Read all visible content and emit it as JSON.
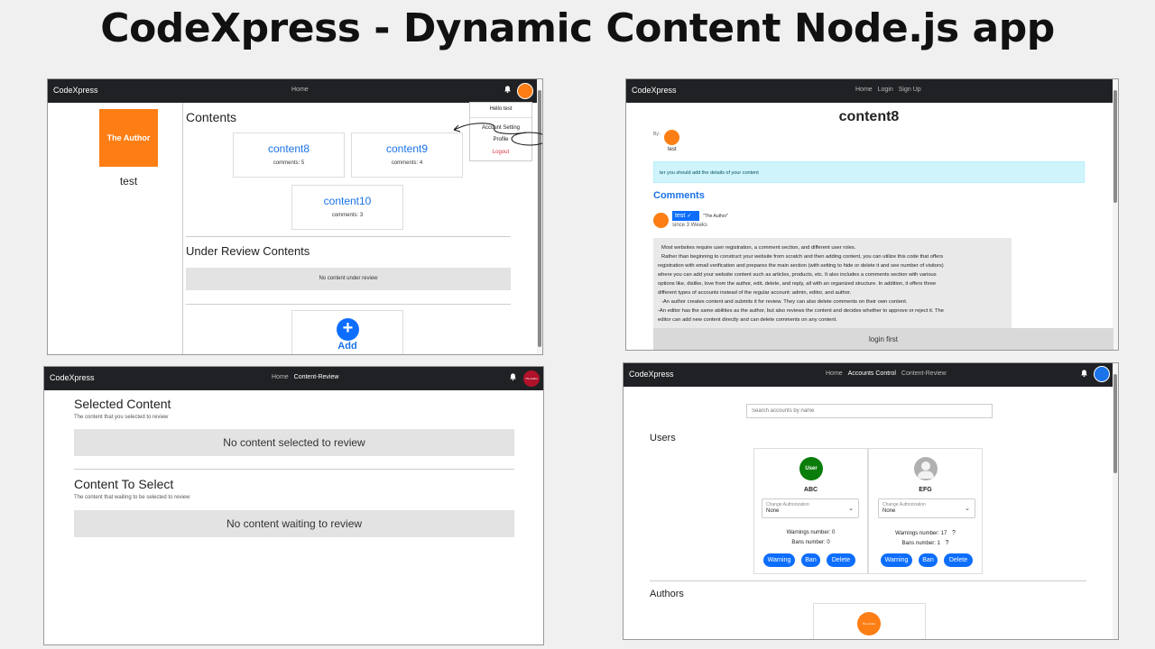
{
  "title": "CodeXpress - Dynamic Content Node.js app",
  "s1": {
    "brand": "CodeXpress",
    "nav": [
      "Home"
    ],
    "author_block": "The Author",
    "username": "test",
    "contents_heading": "Contents",
    "cards": [
      {
        "title": "content8",
        "comments": "comments: 5"
      },
      {
        "title": "content9",
        "comments": "comments: 4"
      },
      {
        "title": "content10",
        "comments": "comments: 3"
      }
    ],
    "under_review_heading": "Under Review Contents",
    "no_review": "No content under review",
    "add_label": "Add",
    "add_symbol": "+",
    "dropdown": {
      "hello": "Hello test",
      "account_setting": "Account Setting",
      "profile": "Profile",
      "logout": "Logout"
    }
  },
  "s2": {
    "brand": "CodeXpress",
    "nav": [
      "Home",
      "Login",
      "Sign Up"
    ],
    "title": "content8",
    "by": "By:",
    "author": "test",
    "info": "ter you should add the details of your content",
    "comments_heading": "Comments",
    "commenter": "test",
    "check": "✓",
    "role": "\"The Author\"",
    "since": "since 3 Weeks",
    "body": [
      "Most websites require user registration, a comment section, and different user roles.",
      "Rather than beginning to construct your website from scratch and then adding content, you can utilize this code that offers",
      "registration with email verification and prepares the main section (with setting to hide or delete it and see number of visitors)",
      "where you can add your website content such as articles, products, etc. It also includes a comments section with various",
      "options like, dislike, love from the author, edit, delete, and reply, all with an organized structure. In addition, it offers three",
      "different types of accounts instead of the regular account: admin, editor, and author.",
      "-An author creates content and submits it for review. They can also delete comments on their own content.",
      "-An editor has the same abilities as the author, but also reviews the content and decides whether to approve or reject it. The",
      "editor can add new content directly and can delete comments on any content."
    ],
    "login_first": "login first"
  },
  "s3": {
    "brand": "CodeXpress",
    "nav": [
      "Home",
      "Content-Review"
    ],
    "avatar_text": "The Editor",
    "selected_heading": "Selected Content",
    "selected_sub": "The content that you selected to review",
    "no_selected": "No content selected to review",
    "select_heading": "Content To Select",
    "select_sub": "The content that waiting to be selected to review",
    "no_waiting": "No content waiting to review"
  },
  "s4": {
    "brand": "CodeXpress",
    "nav": [
      "Home",
      "Accounts Control",
      "Content-Review"
    ],
    "search_placeholder": "Search accounts by name",
    "users_heading": "Users",
    "users": [
      {
        "avatar": "User",
        "name": "ABC",
        "auth_label": "Change Authorization",
        "auth_value": "None",
        "warnings": "Warnings number: 0",
        "bans": "Bans number: 0",
        "help": ""
      },
      {
        "avatar": "",
        "name": "EFG",
        "auth_label": "Change Authorization",
        "auth_value": "None",
        "warnings": "Warnings number: 17",
        "bans": "Bans number: 1",
        "help": "?"
      }
    ],
    "buttons": [
      "Warning",
      "Ban",
      "Delete"
    ],
    "authors_heading": "Authors",
    "author_avatar": "The Author"
  },
  "colors": {
    "navbar": "#202124",
    "primary": "#0d6efd",
    "orange": "#fd7e14",
    "link_blue": "#1a73e8",
    "editor_red": "#b0122a",
    "user_green": "#0a7d0a",
    "info_bg": "#cff4fc"
  }
}
